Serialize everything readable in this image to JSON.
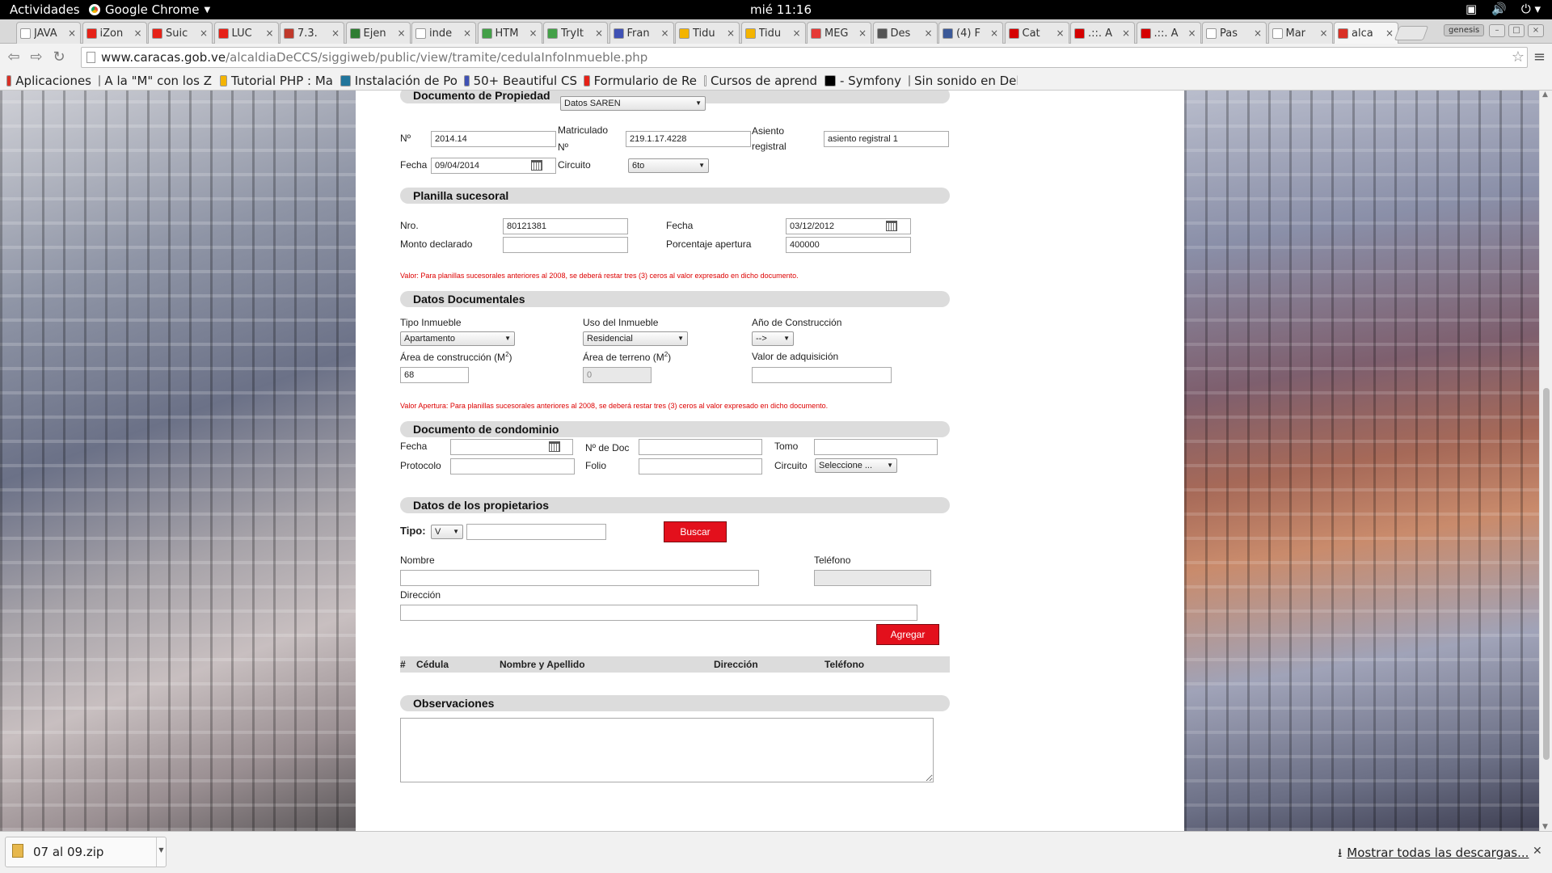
{
  "topbar": {
    "activities": "Actividades",
    "app_name": "Google Chrome",
    "clock": "mié 11:16"
  },
  "tabs": [
    {
      "title": "JAVA",
      "icon_color": "#ffffff"
    },
    {
      "title": "iZon",
      "icon_color": "#e62117"
    },
    {
      "title": "Suic",
      "icon_color": "#e62117"
    },
    {
      "title": "LUC",
      "icon_color": "#e62117"
    },
    {
      "title": "7.3.",
      "icon_color": "#c0392b"
    },
    {
      "title": "Ejen",
      "icon_color": "#2e7d32"
    },
    {
      "title": "inde",
      "icon_color": "#ffffff"
    },
    {
      "title": "HTM",
      "icon_color": "#43a047"
    },
    {
      "title": "TryIt",
      "icon_color": "#43a047"
    },
    {
      "title": "Fran",
      "icon_color": "#3f51b5"
    },
    {
      "title": "Tidu",
      "icon_color": "#f4b400"
    },
    {
      "title": "Tidu",
      "icon_color": "#f4b400"
    },
    {
      "title": "MEG",
      "icon_color": "#e53935"
    },
    {
      "title": "Des",
      "icon_color": "#555555"
    },
    {
      "title": "(4) F",
      "icon_color": "#3b5998"
    },
    {
      "title": "Cat",
      "icon_color": "#d50000"
    },
    {
      "title": ".::. A",
      "icon_color": "#d50000"
    },
    {
      "title": ".::. A",
      "icon_color": "#d50000"
    },
    {
      "title": "Pas",
      "icon_color": "#ffffff"
    },
    {
      "title": "Mar",
      "icon_color": "#ffffff"
    },
    {
      "title": "alca",
      "icon_color": "#d93025"
    }
  ],
  "profile": "genesis",
  "address": {
    "host": "www.caracas.gob.ve",
    "path": "/alcaldiaDeCCS/siggiweb/public/view/tramite/cedulaInfoInmueble.php"
  },
  "bookmarks": [
    {
      "label": "Aplicaciones",
      "icon_color": "#d93025"
    },
    {
      "label": "A la \"M\" con los Z",
      "icon_color": "#333333"
    },
    {
      "label": "Tutorial PHP : Ma",
      "icon_color": "#f4b400"
    },
    {
      "label": "Instalación de Po",
      "icon_color": "#21759b"
    },
    {
      "label": "50+ Beautiful CS",
      "icon_color": "#3f51b5"
    },
    {
      "label": "Formulario de Re",
      "icon_color": "#e62117"
    },
    {
      "label": "Cursos de aprend",
      "icon_color": "#ffffff"
    },
    {
      "label": "- Symfony",
      "icon_color": "#000000"
    },
    {
      "label": "Sin sonido en Del",
      "icon_color": "#222222"
    }
  ],
  "form": {
    "doc_propiedad": {
      "title": "Documento de Propiedad",
      "select": "Datos SAREN",
      "no_label": "Nº",
      "no_value": "2014.14",
      "matriculado_label1": "Matriculado",
      "matriculado_label2": "Nº",
      "matriculado_value": "219.1.17.4228",
      "asiento_label1": "Asiento",
      "asiento_label2": "registral",
      "asiento_value": "asiento registral 1",
      "fecha_label": "Fecha",
      "fecha_value": "09/04/2014",
      "circuito_label": "Circuito",
      "circuito_value": "6to"
    },
    "planilla": {
      "title": "Planilla sucesoral",
      "nro_label": "Nro.",
      "nro_value": "80121381",
      "fecha_label": "Fecha",
      "fecha_value": "03/12/2012",
      "monto_label": "Monto declarado",
      "monto_value": "",
      "porcentaje_label": "Porcentaje apertura",
      "porcentaje_value": "400000",
      "note": "Valor: Para planillas sucesorales anteriores al 2008, se deberá restar tres (3) ceros al valor expresado en dicho documento."
    },
    "datos_doc": {
      "title": "Datos Documentales",
      "tipo_label": "Tipo Inmueble",
      "tipo_value": "Apartamento",
      "uso_label": "Uso del Inmueble",
      "uso_value": "Residencial",
      "anio_label": "Año de Construcción",
      "anio_value": "-->",
      "area_const_label": "Área de construcción (M",
      "area_const_sup": "2",
      "area_const_close": ")",
      "area_const_value": "68",
      "area_terreno_label": "Área de terreno (M",
      "area_terreno_sup": "2",
      "area_terreno_close": ")",
      "area_terreno_value": "0",
      "valor_label": "Valor de adquisición",
      "valor_value": "",
      "note": "Valor Apertura: Para planillas sucesorales anteriores al 2008, se deberá restar tres (3) ceros al valor expresado en dicho documento."
    },
    "condominio": {
      "title": "Documento de condominio",
      "fecha_label": "Fecha",
      "ndoc_label": "Nº de Doc",
      "tomo_label": "Tomo",
      "protocolo_label": "Protocolo",
      "folio_label": "Folio",
      "circuito_label": "Circuito",
      "circuito_value": "Seleccione ..."
    },
    "propietarios": {
      "title": "Datos de los propietarios",
      "tipo_label": "Tipo:",
      "tipo_value": "V",
      "buscar": "Buscar",
      "nombre_label": "Nombre",
      "telefono_label": "Teléfono",
      "direccion_label": "Dirección",
      "agregar": "Agregar",
      "columns": [
        "#",
        "Cédula",
        "Nombre y Apellido",
        "Dirección",
        "Teléfono"
      ]
    },
    "observaciones": {
      "title": "Observaciones"
    }
  },
  "downloads": {
    "file": "07 al 09.zip",
    "show_all": "Mostrar todas las descargas..."
  }
}
